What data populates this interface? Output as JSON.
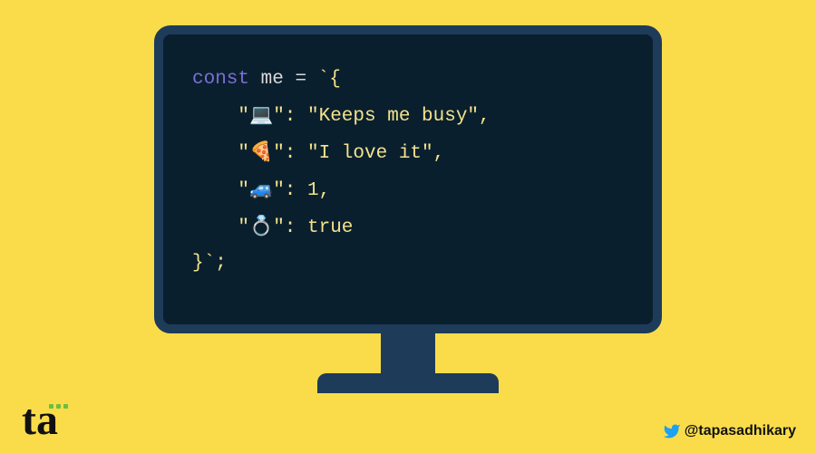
{
  "code": {
    "keyword": "const",
    "varname": "me",
    "operator": "=",
    "tick_open": "`{",
    "tick_close": "}`;",
    "entries": [
      {
        "key": "💻",
        "value": "\"Keeps me busy\"",
        "comma": ","
      },
      {
        "key": "🍕",
        "value": "\"I love it\"",
        "comma": ","
      },
      {
        "key": "🚙",
        "value": "1",
        "comma": ","
      },
      {
        "key": "💍",
        "value": "true",
        "comma": ""
      }
    ]
  },
  "logo_text": "ta",
  "handle": "@tapasadhikary",
  "colors": {
    "background": "#fadc4a",
    "monitor_frame": "#1f3b5a",
    "screen": "#0a1f2e",
    "keyword": "#7a6fd4",
    "string": "#f3e38b"
  }
}
